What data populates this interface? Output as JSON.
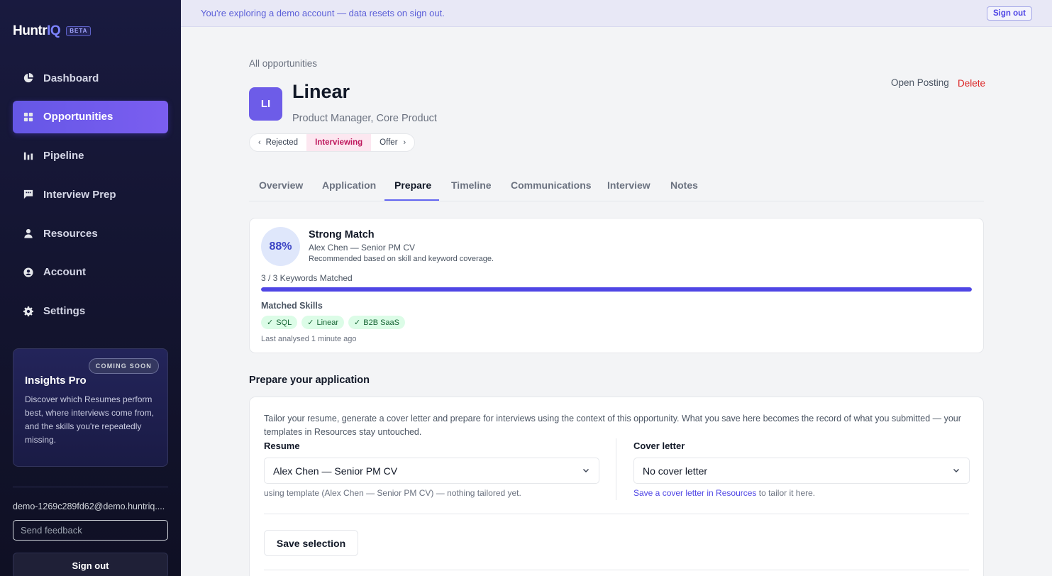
{
  "app": {
    "logo_main": "Huntr",
    "logo_accent": "IQ",
    "beta_badge": "BETA"
  },
  "sidebar": {
    "items": [
      {
        "label": "Dashboard",
        "icon": "pie-chart-icon",
        "active": false
      },
      {
        "label": "Opportunities",
        "icon": "grid-icon",
        "active": true
      },
      {
        "label": "Pipeline",
        "icon": "bar-chart-icon",
        "active": false
      },
      {
        "label": "Interview Prep",
        "icon": "chat-icon",
        "active": false
      },
      {
        "label": "Resources",
        "icon": "user-icon",
        "active": false
      },
      {
        "label": "Account",
        "icon": "account-circle-icon",
        "active": false
      },
      {
        "label": "Settings",
        "icon": "gear-icon",
        "active": false
      }
    ],
    "promo": {
      "badge": "COMING SOON",
      "title": "Insights Pro",
      "text": "Discover which Resumes perform best, where interviews come from, and the skills you're repeatedly missing."
    },
    "email": "demo-1269c289fd62@demo.huntriq....",
    "feedback_placeholder": "Send feedback",
    "signout_label": "Sign out"
  },
  "banner": {
    "text": "You're exploring a demo account — data resets on sign out.",
    "signout_label": "Sign out"
  },
  "header": {
    "breadcrumb": "All opportunities",
    "avatar_initials": "LI",
    "company": "Linear",
    "role": "Product Manager, Core Product",
    "open_posting": "Open Posting",
    "delete": "Delete"
  },
  "stages": {
    "prev": "Rejected",
    "current": "Interviewing",
    "next": "Offer"
  },
  "tabs": [
    {
      "label": "Overview",
      "active": false
    },
    {
      "label": "Application",
      "active": false
    },
    {
      "label": "Prepare",
      "active": true
    },
    {
      "label": "Timeline",
      "active": false
    },
    {
      "label": "Communications",
      "active": false
    },
    {
      "label": "Interview",
      "active": false
    },
    {
      "label": "Notes",
      "active": false
    }
  ],
  "match": {
    "score": "88%",
    "title": "Strong Match",
    "subtitle": "Alex Chen — Senior PM CV",
    "recommendation": "Recommended based on skill and keyword coverage.",
    "keywords": "3 / 3 Keywords Matched",
    "keywords_fraction": 1.0,
    "skills_label": "Matched Skills",
    "skills": [
      "SQL",
      "Linear",
      "B2B SaaS"
    ],
    "check_glyph": "✓",
    "last_analysed": "Last analysed 1 minute ago"
  },
  "prepare": {
    "section_title": "Prepare your application",
    "description": "Tailor your resume, generate a cover letter and prepare for interviews using the context of this opportunity. What you save here becomes the record of what you submitted — your templates in Resources stay untouched.",
    "resume_label": "Resume",
    "resume_value": "Alex Chen — Senior PM CV",
    "resume_note": "using template (Alex Chen — Senior PM CV) — nothing tailored yet.",
    "cover_label": "Cover letter",
    "cover_value": "No cover letter",
    "cover_note_link": "Save a cover letter in Resources",
    "cover_note_rest": " to tailor it here.",
    "save_label": "Save selection"
  },
  "colors": {
    "accent": "#6366f1",
    "sidebar_bg": "#141531",
    "active_nav": "#6557e6",
    "danger": "#dc2626",
    "stage_current": "#be185d"
  }
}
